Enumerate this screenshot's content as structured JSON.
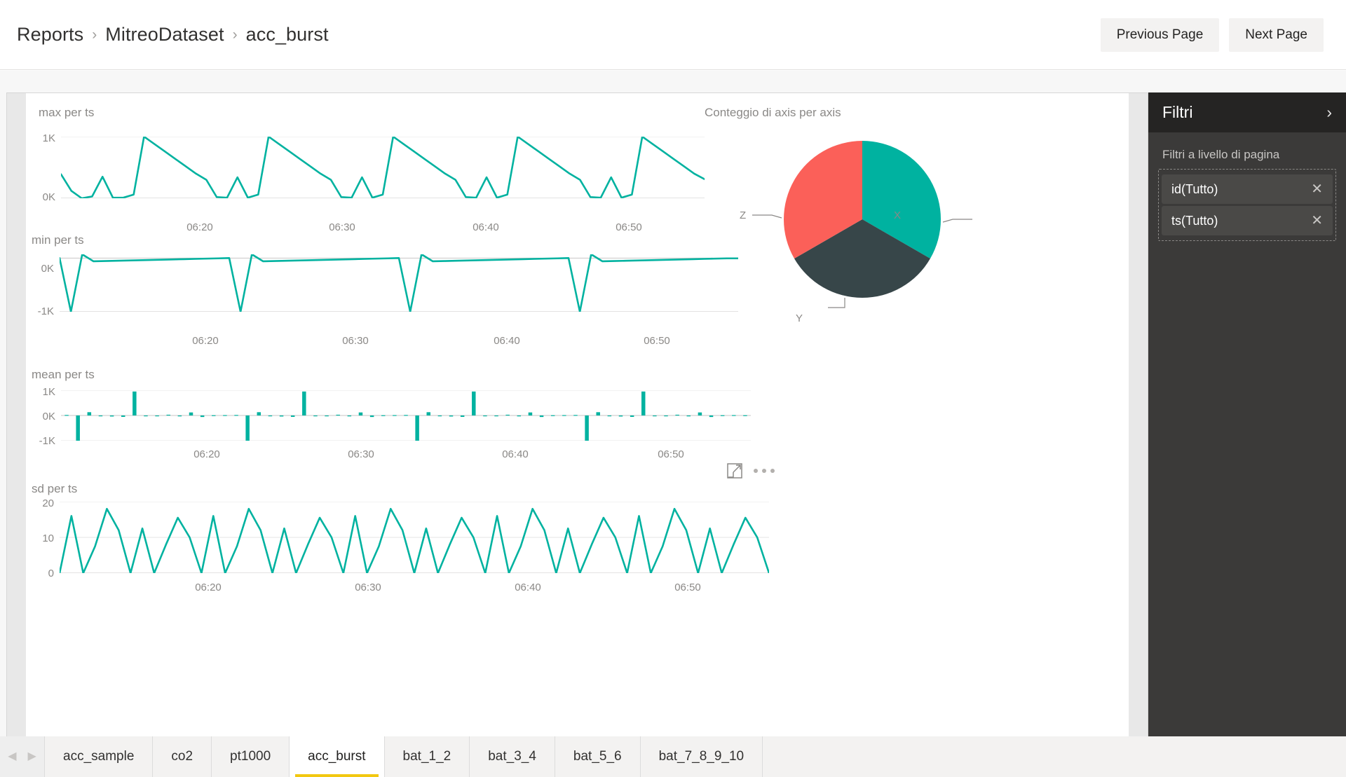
{
  "header": {
    "breadcrumb": [
      {
        "label": "Reports",
        "sep": "›"
      },
      {
        "label": "MitreoDataset",
        "sep": "›"
      },
      {
        "label": "acc_burst",
        "sep": ""
      }
    ],
    "previous_page_label": "Previous Page",
    "next_page_label": "Next Page"
  },
  "filters": {
    "title": "Filtri",
    "expand_icon": "›",
    "section_label": "Filtri a livello di pagina",
    "cards": [
      {
        "name": "id(Tutto)",
        "remove_icon": "✕"
      },
      {
        "name": "ts(Tutto)",
        "remove_icon": "✕"
      }
    ]
  },
  "visual_actions": {
    "focus_icon": "focus-mode-icon",
    "more_icon": "more-options-icon"
  },
  "tabbar": {
    "prev_icon": "◀",
    "next_icon": "▶",
    "tabs": [
      {
        "label": "acc_sample",
        "active": false
      },
      {
        "label": "co2",
        "active": false
      },
      {
        "label": "pt1000",
        "active": false
      },
      {
        "label": "acc_burst",
        "active": true
      },
      {
        "label": "bat_1_2",
        "active": false
      },
      {
        "label": "bat_3_4",
        "active": false
      },
      {
        "label": "bat_5_6",
        "active": false
      },
      {
        "label": "bat_7_8_9_10",
        "active": false
      }
    ]
  },
  "colors": {
    "accent_teal": "#00B2A0",
    "pie_x": "#00B2A0",
    "pie_y": "#374649",
    "pie_z": "#FB6059",
    "tab_active_underline": "#F2C811",
    "filters_header_bg": "#252423",
    "filters_body_bg": "#3B3A39",
    "axis_text": "#8A8886",
    "gridline": "#E6E6E6"
  },
  "chart_data": [
    {
      "type": "line",
      "title": "max per ts",
      "xlabel": "",
      "ylabel": "",
      "ylim": [
        0,
        1000
      ],
      "yticks": [
        0,
        1000
      ],
      "ytick_labels": [
        "0K",
        "1K"
      ],
      "xticks": [
        "06:20",
        "06:30",
        "06:40",
        "06:50"
      ],
      "grid": true,
      "legend": "none",
      "series": [
        {
          "name": "max",
          "values": [
            390,
            120,
            0,
            30,
            350,
            10,
            10,
            60,
            1000,
            880,
            760,
            640,
            520,
            400,
            300,
            20,
            10,
            340,
            10,
            60,
            1000,
            880,
            760,
            640,
            520,
            400,
            300,
            20,
            10,
            340,
            10,
            60,
            1000,
            880,
            760,
            640,
            520,
            400,
            300,
            20,
            10,
            340,
            10,
            60,
            1000,
            880,
            760,
            640,
            520,
            400,
            300,
            20,
            10,
            340,
            10,
            60,
            1000,
            880,
            760,
            640,
            520,
            400,
            310
          ]
        }
      ]
    },
    {
      "type": "line",
      "title": "min per ts",
      "xlabel": "",
      "ylabel": "",
      "ylim": [
        -1000,
        70
      ],
      "yticks": [
        -1000,
        0
      ],
      "ytick_labels": [
        "-1K",
        "0K"
      ],
      "xticks": [
        "06:20",
        "06:30",
        "06:40",
        "06:50"
      ],
      "grid": true,
      "legend": "none",
      "series": [
        {
          "name": "min",
          "values": [
            0,
            -1000,
            70,
            -60,
            -55,
            -50,
            -45,
            -40,
            -35,
            -30,
            -25,
            -20,
            -15,
            -10,
            -5,
            0,
            -1000,
            70,
            -60,
            -55,
            -50,
            -45,
            -40,
            -35,
            -30,
            -25,
            -20,
            -15,
            -10,
            -5,
            0,
            -1000,
            70,
            -60,
            -55,
            -50,
            -45,
            -40,
            -35,
            -30,
            -25,
            -20,
            -15,
            -10,
            -5,
            0,
            -1000,
            70,
            -60,
            -55,
            -50,
            -45,
            -40,
            -35,
            -30,
            -25,
            -20,
            -15,
            -10,
            -5,
            -5
          ]
        }
      ]
    },
    {
      "type": "bar",
      "title": "mean per ts",
      "xlabel": "",
      "ylabel": "",
      "ylim": [
        -1000,
        1000
      ],
      "yticks": [
        -1000,
        0,
        1000
      ],
      "ytick_labels": [
        "-1K",
        "0K",
        "1K"
      ],
      "xticks": [
        "06:20",
        "06:30",
        "06:40",
        "06:50"
      ],
      "grid": true,
      "legend": "none",
      "series": [
        {
          "name": "mean",
          "values": [
            20,
            -1000,
            130,
            -25,
            -40,
            -55,
            950,
            0,
            0,
            30,
            -35,
            120,
            -60,
            10,
            15,
            20,
            -1000,
            130,
            -25,
            -40,
            -55,
            950,
            0,
            0,
            30,
            -35,
            120,
            -60,
            10,
            15,
            20,
            -1000,
            130,
            -25,
            -40,
            -55,
            950,
            0,
            0,
            30,
            -35,
            120,
            -60,
            10,
            15,
            20,
            -1000,
            130,
            -25,
            -40,
            -55,
            950,
            0,
            0,
            30,
            -35,
            120,
            -60,
            10,
            15,
            10
          ]
        }
      ]
    },
    {
      "type": "line",
      "title": "sd per ts",
      "xlabel": "",
      "ylabel": "",
      "ylim": [
        0,
        20
      ],
      "yticks": [
        0,
        10,
        20
      ],
      "ytick_labels": [
        "0",
        "10",
        "20"
      ],
      "xticks": [
        "06:20",
        "06:30",
        "06:40",
        "06:50"
      ],
      "grid": true,
      "legend": "none",
      "series": [
        {
          "name": "sd",
          "values": [
            0,
            16,
            0,
            7.5,
            18,
            12,
            0,
            12.5,
            0,
            8,
            15.5,
            10,
            0,
            16,
            0,
            7.5,
            18,
            12,
            0,
            12.5,
            0,
            8,
            15.5,
            10,
            0,
            16,
            0,
            7.5,
            18,
            12,
            0,
            12.5,
            0,
            8,
            15.5,
            10,
            0,
            16,
            0,
            7.5,
            18,
            12,
            0,
            12.5,
            0,
            8,
            15.5,
            10,
            0,
            16,
            0,
            7.5,
            18,
            12,
            0,
            12.5,
            0,
            8,
            15.5,
            10,
            0
          ]
        }
      ]
    },
    {
      "type": "pie",
      "title": "Conteggio di axis per axis",
      "labels": [
        "X",
        "Y",
        "Z"
      ],
      "values": [
        33.34,
        33.33,
        33.33
      ],
      "slice_colors": [
        "#00B2A0",
        "#374649",
        "#FB6059"
      ],
      "legend": "callout-labels"
    }
  ]
}
